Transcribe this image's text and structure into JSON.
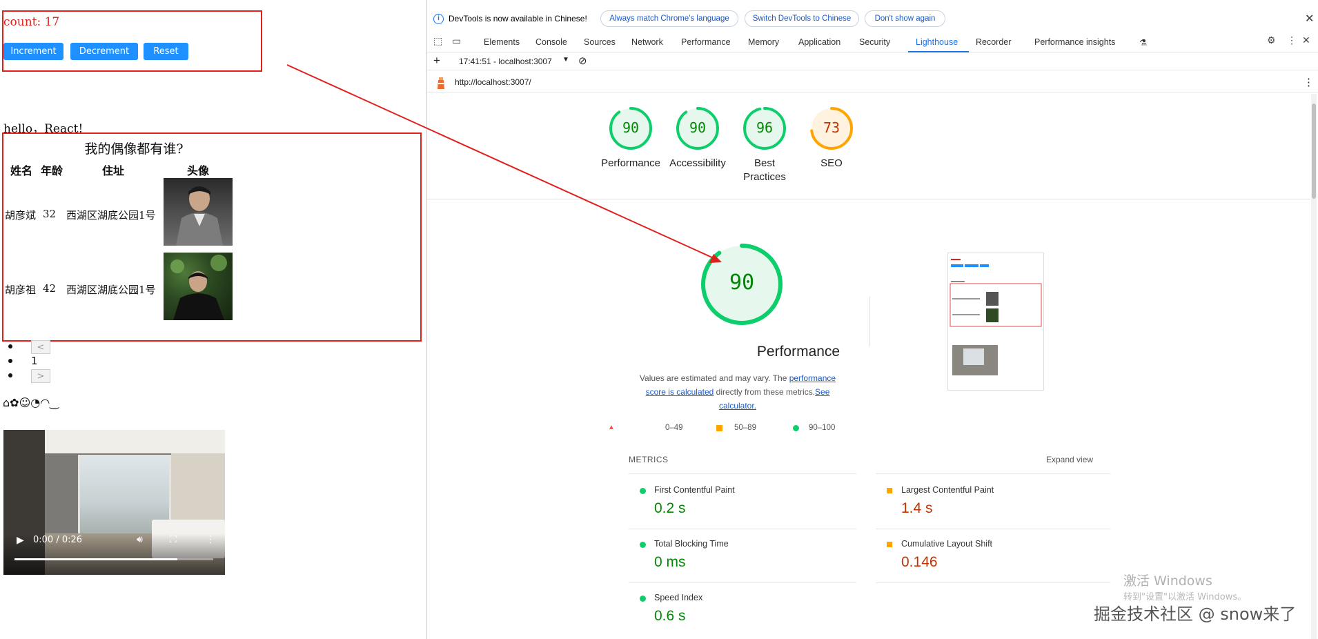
{
  "app": {
    "count_text": "count: 17",
    "buttons": {
      "increment": "Increment",
      "decrement": "Decrement",
      "reset": "Reset"
    },
    "hello": "hello，React!",
    "table": {
      "caption": "我的偶像都有谁?",
      "headers": [
        "姓名",
        "年龄",
        "住址",
        "头像"
      ],
      "rows": [
        {
          "name": "胡彦斌",
          "age": "32",
          "address": "西湖区湖底公园1号"
        },
        {
          "name": "胡彦祖",
          "age": "42",
          "address": "西湖区湖底公园1号"
        }
      ]
    },
    "pagination": {
      "prev": "<",
      "page": "1",
      "next": ">"
    },
    "icons_row": "⌂✿☺◔◠‿",
    "video": {
      "time": "0:00 / 0:26",
      "progress_fraction": 0.82
    }
  },
  "devtools": {
    "info": {
      "text": "DevTools is now available in Chinese!",
      "btn_match": "Always match Chrome's language",
      "btn_switch": "Switch DevTools to Chinese",
      "btn_dont_show": "Don't show again"
    },
    "tabs": [
      "Elements",
      "Console",
      "Sources",
      "Network",
      "Performance",
      "Memory",
      "Application",
      "Security",
      "Lighthouse",
      "Recorder",
      "Performance insights"
    ],
    "active_tab": "Lighthouse",
    "report_selector": "17:41:51 - localhost:3007",
    "url": "http://localhost:3007/",
    "scores": [
      {
        "label": "Performance",
        "value": "90",
        "color": "#0cce6b"
      },
      {
        "label": "Accessibility",
        "value": "90",
        "color": "#0cce6b"
      },
      {
        "label": "Best Practices",
        "value": "96",
        "color": "#0cce6b"
      },
      {
        "label": "SEO",
        "value": "73",
        "color": "#ffa400"
      }
    ],
    "big_gauge": {
      "value": "90",
      "title": "Performance"
    },
    "description": {
      "prefix": "Values are estimated and may vary. The ",
      "link1": "performance score is calculated",
      "middle": " directly from these metrics.",
      "link2": "See calculator."
    },
    "legend": [
      "0–49",
      "50–89",
      "90–100"
    ],
    "metrics_header": "METRICS",
    "expand_view": "Expand view",
    "metrics": [
      {
        "name": "First Contentful Paint",
        "value": "0.2 s",
        "status": "good"
      },
      {
        "name": "Largest Contentful Paint",
        "value": "1.4 s",
        "status": "average"
      },
      {
        "name": "Total Blocking Time",
        "value": "0 ms",
        "status": "good"
      },
      {
        "name": "Cumulative Layout Shift",
        "value": "0.146",
        "status": "average"
      },
      {
        "name": "Speed Index",
        "value": "0.6 s",
        "status": "good"
      }
    ],
    "colors": {
      "good": "#0cce6b",
      "good_text": "#008800",
      "average": "#ffa400",
      "average_text": "#c33300",
      "fail": "#ff4e42",
      "accent": "#1a73e8"
    }
  },
  "watermarks": {
    "windows_title": "激活 Windows",
    "windows_sub": "转到\"设置\"以激活 Windows。",
    "site": "掘金技术社区 @ snow来了"
  }
}
